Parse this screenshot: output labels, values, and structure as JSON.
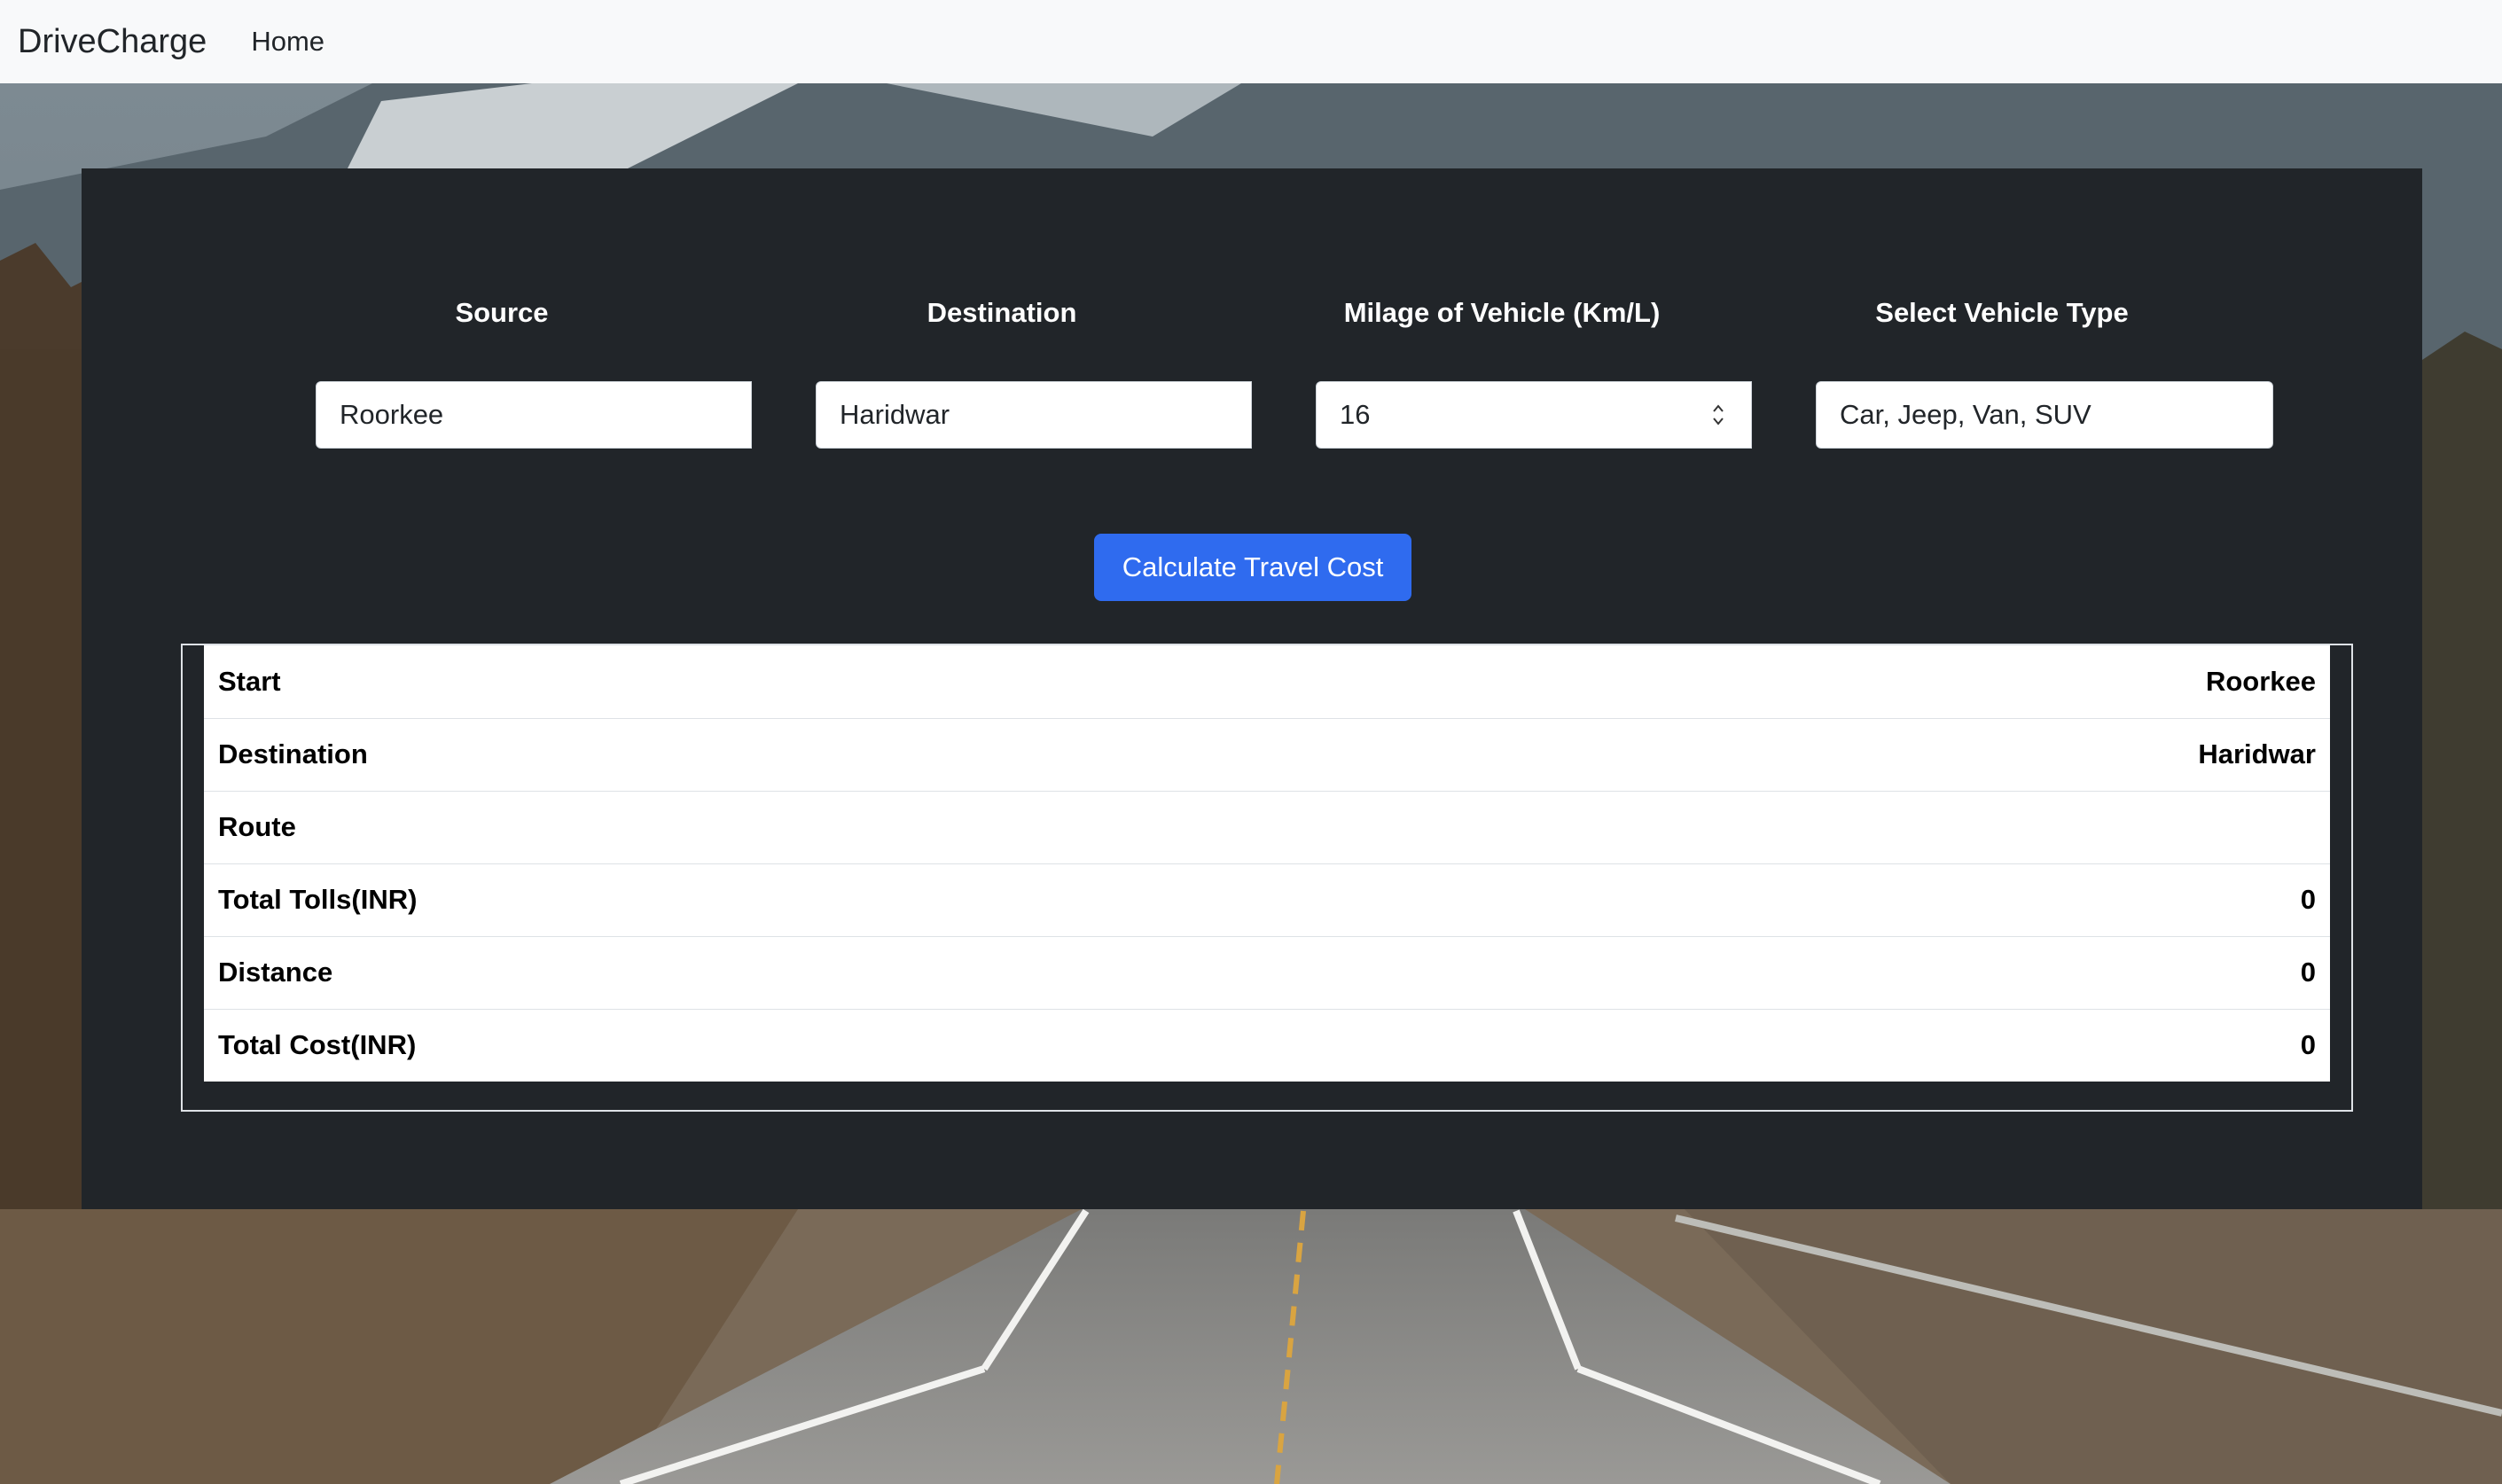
{
  "navbar": {
    "brand": "DriveCharge",
    "links": [
      "Home"
    ]
  },
  "form": {
    "source": {
      "label": "Source",
      "value": "Roorkee"
    },
    "destination": {
      "label": "Destination",
      "value": "Haridwar"
    },
    "mileage": {
      "label": "Milage of Vehicle (Km/L)",
      "value": "16"
    },
    "vehicle_type": {
      "label": "Select Vehicle Type",
      "value": "Car, Jeep, Van, SUV"
    },
    "submit_label": "Calculate Travel Cost"
  },
  "results": [
    {
      "label": "Start",
      "value": "Roorkee"
    },
    {
      "label": "Destination",
      "value": "Haridwar"
    },
    {
      "label": "Route",
      "value": ""
    },
    {
      "label": "Total Tolls(INR)",
      "value": "0"
    },
    {
      "label": "Distance",
      "value": "0"
    },
    {
      "label": "Total Cost(INR)",
      "value": "0"
    }
  ],
  "colors": {
    "navbar_bg": "#f8f9fa",
    "panel_bg": "#212529",
    "button_bg": "#2f6bef"
  }
}
